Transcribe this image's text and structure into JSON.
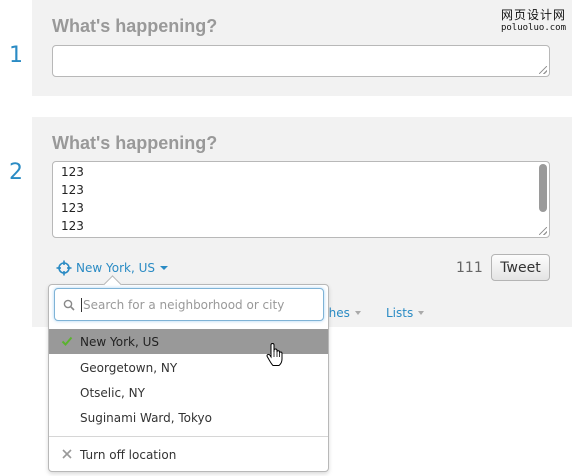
{
  "steps": [
    "1",
    "2"
  ],
  "composer1": {
    "heading": "What's happening?",
    "text": ""
  },
  "composer2": {
    "heading": "What's happening?",
    "lines": [
      "123",
      "123",
      "123",
      "123"
    ]
  },
  "location": {
    "current": "New York, US",
    "search_placeholder": "Search for a neighborhood or city",
    "options": [
      "New York, US",
      "Georgetown, NY",
      "Otselic, NY",
      "Suginami Ward, Tokyo"
    ],
    "selected_index": 0,
    "turn_off_label": "Turn off location"
  },
  "char_count": "111",
  "tweet_label": "Tweet",
  "tabs": {
    "searches_partial": "ches",
    "lists": "Lists"
  },
  "watermark": {
    "main": "网页设计网",
    "sub": "poluoluo.com"
  },
  "colors": {
    "accent": "#2a8bc4",
    "panel_bg": "#f2f2f2",
    "selected_bg": "#999999",
    "check_green": "#5bb32f",
    "heading_gray": "#999999"
  },
  "icons": {
    "location": "crosshair-icon",
    "search": "search-icon",
    "selected": "check-icon",
    "turn_off": "x-icon",
    "cursor": "hand-pointer-icon"
  }
}
